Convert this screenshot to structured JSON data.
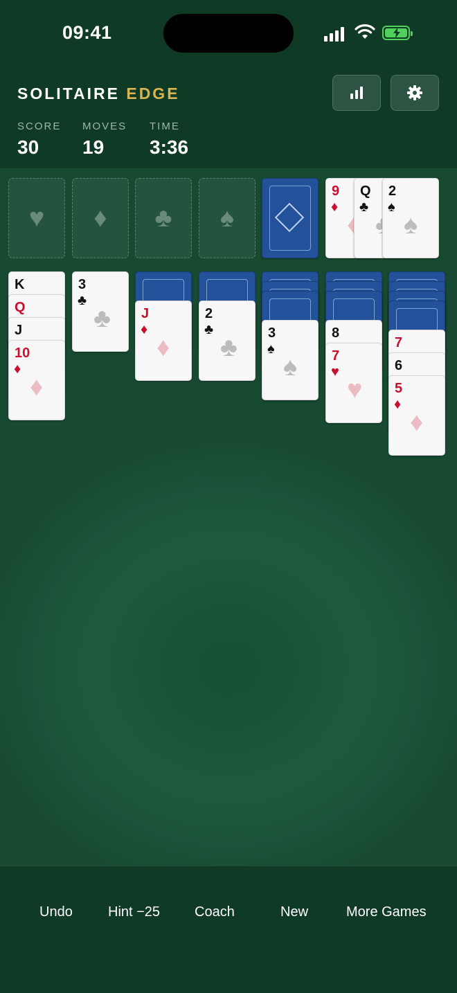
{
  "status": {
    "time": "09:41"
  },
  "header": {
    "brand_main": "SOLITAIRE",
    "brand_accent": "EDGE",
    "stats_icon": "bar-chart-icon",
    "settings_icon": "gear-icon"
  },
  "stats": [
    {
      "label": "SCORE",
      "value": "30"
    },
    {
      "label": "MOVES",
      "value": "19"
    },
    {
      "label": "TIME",
      "value": "3:36"
    }
  ],
  "foundations": [
    {
      "suit": "♥",
      "name": "hearts"
    },
    {
      "suit": "♦",
      "name": "diamonds"
    },
    {
      "suit": "♣",
      "name": "clubs"
    },
    {
      "suit": "♠",
      "name": "spades"
    }
  ],
  "stock": {
    "symbol": "◇"
  },
  "waste": [
    {
      "rank": "9",
      "suit": "♦",
      "color": "red"
    },
    {
      "rank": "Q",
      "suit": "♣",
      "color": "black"
    },
    {
      "rank": "2",
      "suit": "♠",
      "color": "black"
    }
  ],
  "tableau": [
    {
      "face_down": 0,
      "cards": [
        {
          "rank": "K",
          "suit": "",
          "color": "black"
        },
        {
          "rank": "Q",
          "suit": "",
          "color": "red"
        },
        {
          "rank": "J",
          "suit": "",
          "color": "black"
        },
        {
          "rank": "10",
          "suit": "♦",
          "color": "red"
        }
      ]
    },
    {
      "face_down": 0,
      "cards": [
        {
          "rank": "3",
          "suit": "♣",
          "color": "black"
        }
      ]
    },
    {
      "face_down": 1,
      "cards": [
        {
          "rank": "J",
          "suit": "♦",
          "color": "red"
        }
      ]
    },
    {
      "face_down": 1,
      "cards": [
        {
          "rank": "2",
          "suit": "♣",
          "color": "black"
        }
      ]
    },
    {
      "face_down": 3,
      "cards": [
        {
          "rank": "3",
          "suit": "♠",
          "color": "black"
        }
      ]
    },
    {
      "face_down": 3,
      "cards": [
        {
          "rank": "8",
          "suit": "",
          "color": "black"
        },
        {
          "rank": "7",
          "suit": "♥",
          "color": "red"
        }
      ]
    },
    {
      "face_down": 4,
      "cards": [
        {
          "rank": "7",
          "suit": "",
          "color": "red"
        },
        {
          "rank": "6",
          "suit": "",
          "color": "black"
        },
        {
          "rank": "5",
          "suit": "♦",
          "color": "red"
        }
      ]
    }
  ],
  "bottom_nav": [
    {
      "label": "Undo"
    },
    {
      "label": "Hint −25"
    },
    {
      "label": "Coach"
    },
    {
      "label": "New"
    },
    {
      "label": "More Games"
    }
  ],
  "colors": {
    "accent": "#d8b452",
    "felt": "#1e5a3d",
    "card_back": "#23529a",
    "red_suit": "#c8102e"
  }
}
